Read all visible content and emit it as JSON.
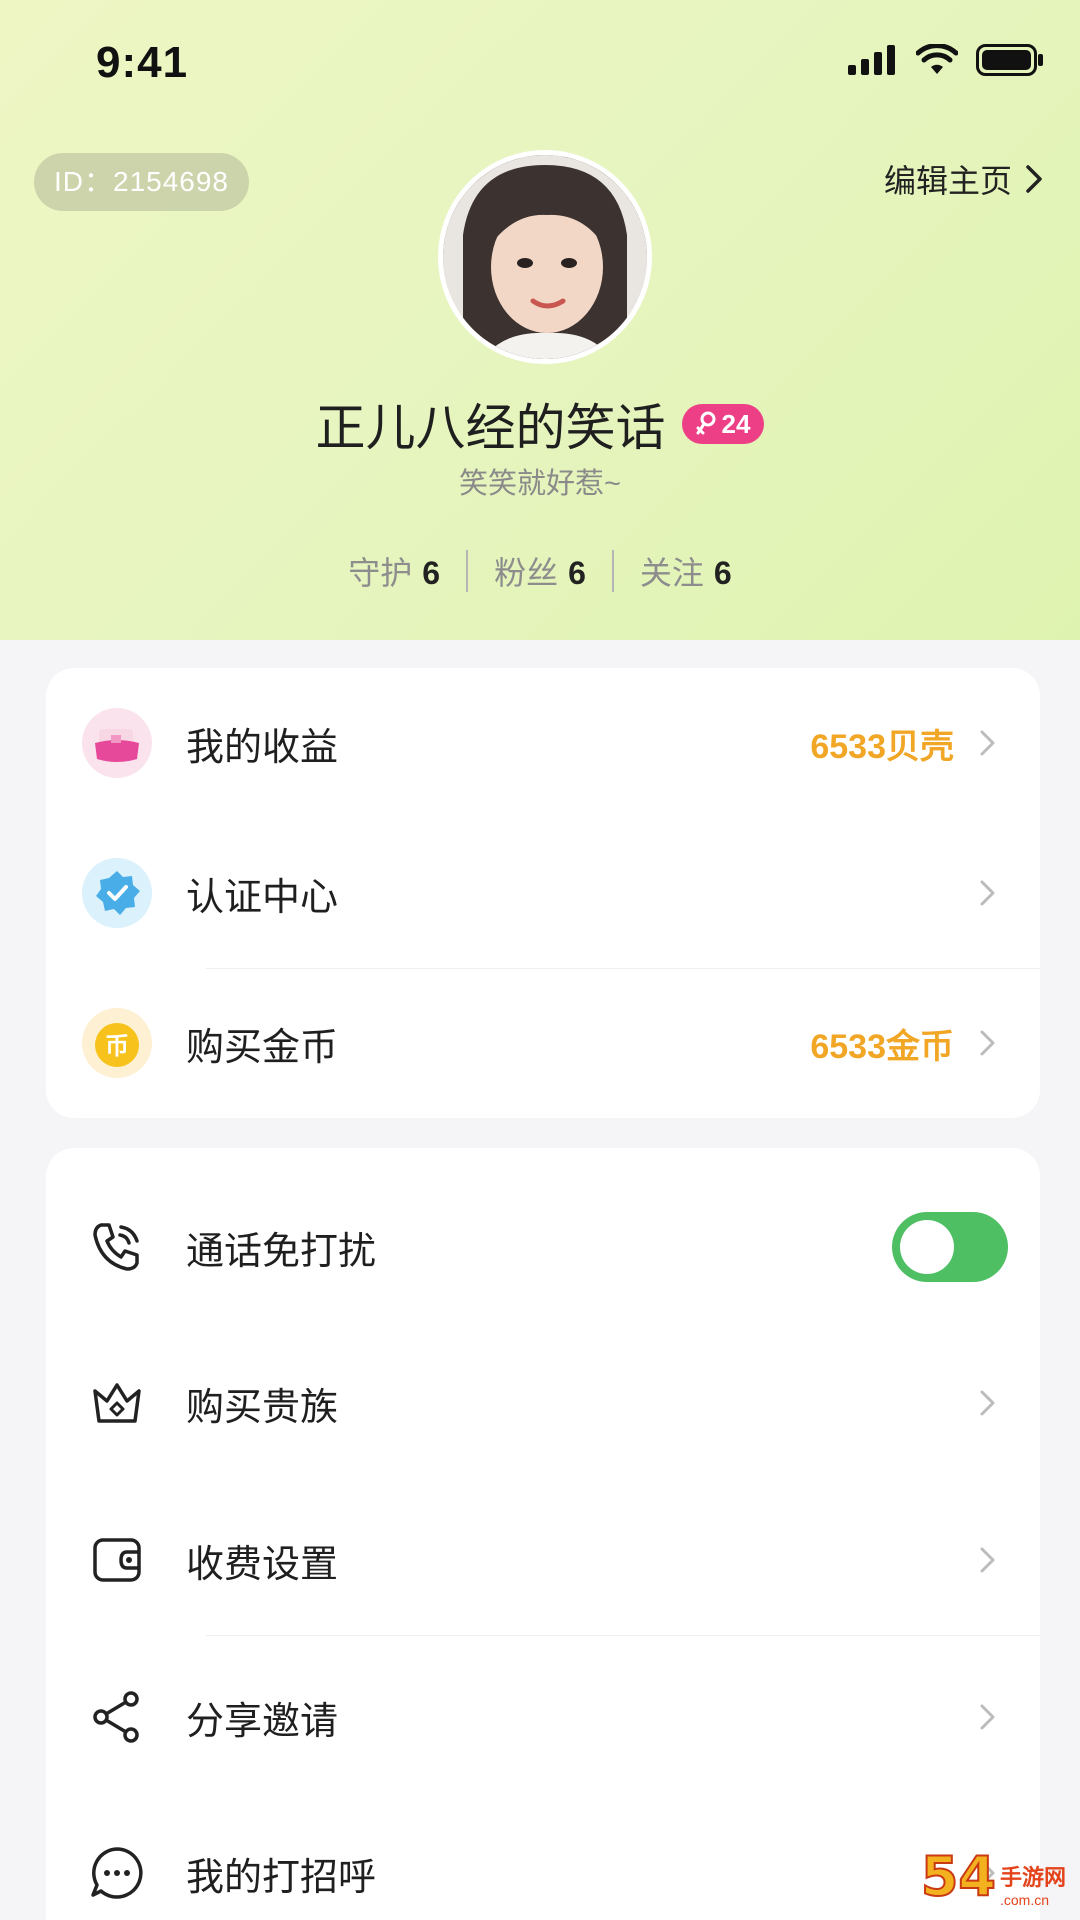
{
  "status_bar": {
    "time": "9:41"
  },
  "profile": {
    "id_label": "ID：2154698",
    "edit_label": "编辑主页",
    "name": "正儿八经的笑话",
    "level": "24",
    "bio": "笑笑就好惹~",
    "stats": [
      {
        "label": "守护",
        "value": "6"
      },
      {
        "label": "粉丝",
        "value": "6"
      },
      {
        "label": "关注",
        "value": "6"
      }
    ]
  },
  "menu_primary": [
    {
      "label": "我的收益",
      "value": "6533贝壳",
      "icon": "wallet-icon"
    },
    {
      "label": "认证中心",
      "value": "",
      "icon": "verified-badge-icon"
    },
    {
      "label": "购买金币",
      "value": "6533金币",
      "icon": "coin-icon"
    }
  ],
  "menu_settings": [
    {
      "label": "通话免打扰",
      "icon": "phone-call-icon",
      "toggle": true
    },
    {
      "label": "购买贵族",
      "icon": "crown-icon"
    },
    {
      "label": "收费设置",
      "icon": "wallet-outline-icon"
    },
    {
      "label": "分享邀请",
      "icon": "share-icon"
    },
    {
      "label": "我的打招呼",
      "icon": "chat-bubble-icon"
    }
  ],
  "watermark": {
    "big": "54",
    "small": "手游网",
    "tiny": ".com.cn"
  },
  "colors": {
    "accent_orange": "#f2a626",
    "toggle_green": "#4fbf64",
    "badge_pink": "#ec3f86"
  }
}
